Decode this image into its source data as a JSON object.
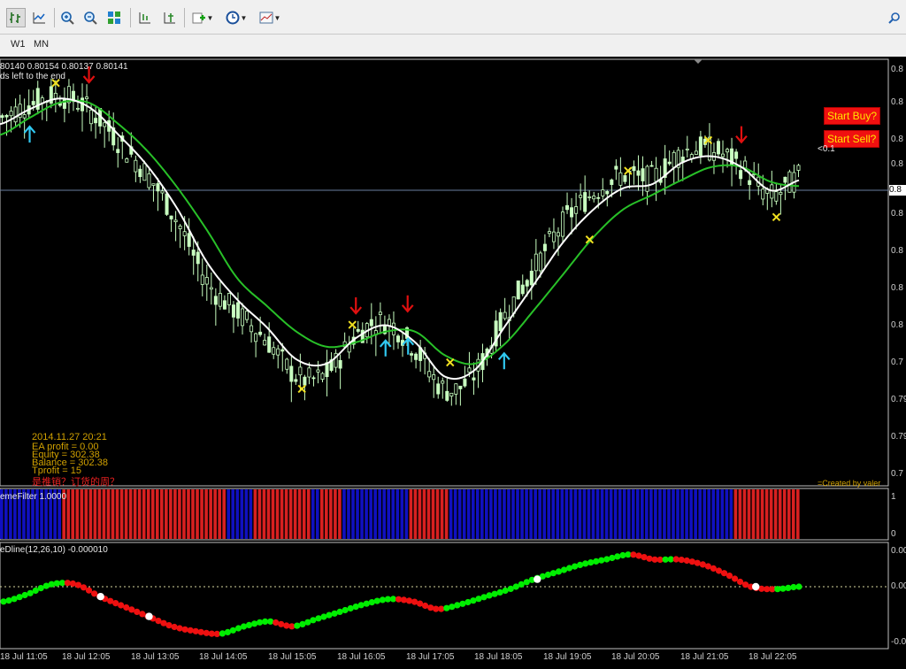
{
  "toolbar": {
    "buttons": [
      {
        "name": "bar-chart-button",
        "icon": "bar-chart-icon"
      },
      {
        "name": "line-chart-button",
        "icon": "line-chart-icon"
      },
      {
        "name": "zoom-in-button",
        "icon": "zoom-in-icon"
      },
      {
        "name": "zoom-out-button",
        "icon": "zoom-out-icon"
      },
      {
        "name": "tile-windows-button",
        "icon": "tile-icon"
      },
      {
        "name": "chart-shift-button",
        "icon": "chart-shift-icon"
      },
      {
        "name": "autoscroll-button",
        "icon": "autoscroll-icon"
      },
      {
        "name": "add-indicator-button",
        "icon": "add-indicator-icon"
      },
      {
        "name": "periods-button",
        "icon": "clock-icon"
      },
      {
        "name": "templates-button",
        "icon": "template-icon"
      }
    ],
    "search_icon": "search-icon"
  },
  "periods": [
    "W1",
    "MN"
  ],
  "main_chart": {
    "ohlc_header": "80140 0.80154 0.80137 0.80141",
    "countdown_label": "ds left to the end",
    "start_buy_label": "Start Buy?",
    "start_sell_label": "Start Sell?",
    "side_value": "<0.1",
    "credit": "=Created by valer",
    "info": {
      "datetime": "2014.11.27 20:21",
      "ea_profit": "EA profit = 0.00",
      "equity": "Equity = 302.38",
      "balance": "Balance = 302.38",
      "tprofit": "Tprofit = 15",
      "warning": "是推销？订货的周？"
    },
    "price_axis_labels": [
      "0.8",
      "0.8",
      "0.8",
      "0.8",
      "0.8",
      "0.8",
      "0.8",
      "0.8",
      "0.7",
      "0.79",
      "0.79",
      "0.7",
      "0.79",
      "0.79"
    ],
    "current_price_label": "0.8"
  },
  "filter_pane": {
    "label": "emeFilter 1.0000",
    "axis_top": "1",
    "axis_bottom": "0"
  },
  "macd_pane": {
    "label": "eDline(12,26,10) -0.000010",
    "axis_top": "0.00",
    "axis_bottom": "0.00",
    "axis_low": "-0.00"
  },
  "time_axis": [
    "18 Jul 11:05",
    "18 Jul 12:05",
    "18 Jul 13:05",
    "18 Jul 14:05",
    "18 Jul 15:05",
    "18 Jul 16:05",
    "18 Jul 17:05",
    "18 Jul 18:05",
    "18 Jul 19:05",
    "18 Jul 20:05",
    "18 Jul 21:05",
    "18 Jul 22:05"
  ],
  "colors": {
    "bull": "#c8ffc0",
    "ma_fast": "#ffffff",
    "ma_slow": "#28c028",
    "filter_red": "#d82020",
    "filter_blue": "#1010c0",
    "dot_green": "#00ee00",
    "dot_red": "#ee1010",
    "arrow_up": "#30c8f0",
    "arrow_down": "#e01010",
    "cross": "#f0e020"
  },
  "chart_data": {
    "type": "line",
    "series": [
      {
        "values": [
          0.808,
          0.8087,
          0.8092,
          0.8088,
          0.8075,
          0.806,
          0.804,
          0.8015,
          0.7998,
          0.7985,
          0.797,
          0.7968,
          0.798,
          0.7986,
          0.7978,
          0.7962,
          0.7965,
          0.7985,
          0.8005,
          0.8025,
          0.804,
          0.805,
          0.8052,
          0.8062,
          0.8065,
          0.806,
          0.8049,
          0.8054
        ]
      },
      {
        "values": [
          0.8075,
          0.8083,
          0.809,
          0.809,
          0.808,
          0.8067,
          0.805,
          0.803,
          0.8008,
          0.7995,
          0.7983,
          0.7976,
          0.7978,
          0.7983,
          0.7983,
          0.7972,
          0.7968,
          0.7977,
          0.7993,
          0.801,
          0.8027,
          0.804,
          0.8047,
          0.8054,
          0.806,
          0.806,
          0.8053,
          0.8051
        ]
      }
    ],
    "filter_states": [
      {
        "state": "blue",
        "bars": 14
      },
      {
        "state": "red",
        "bars": 37
      },
      {
        "state": "blue",
        "bars": 6
      },
      {
        "state": "red",
        "bars": 13
      },
      {
        "state": "blue",
        "bars": 2
      },
      {
        "state": "red",
        "bars": 5
      },
      {
        "state": "blue",
        "bars": 15
      },
      {
        "state": "red",
        "bars": 9
      },
      {
        "state": "blue",
        "bars": 64
      },
      {
        "state": "red",
        "bars": 15
      }
    ],
    "osc": {
      "values": [
        -0.6,
        -0.3,
        0.1,
        0.1,
        -0.4,
        -0.8,
        -1.2,
        -1.6,
        -1.8,
        -1.9,
        -1.6,
        -1.4,
        -1.6,
        -1.3,
        -1.0,
        -0.7,
        -0.5,
        -0.6,
        -0.9,
        -0.7,
        -0.4,
        -0.1,
        0.3,
        0.6,
        0.9,
        1.1,
        1.3,
        1.1,
        1.1,
        0.9,
        0.5,
        0.0,
        -0.1,
        0.0
      ],
      "signal_indices": [
        4,
        6,
        22,
        31
      ]
    },
    "arrows_up": [
      1,
      13,
      14,
      17
    ],
    "arrows_down": [
      3,
      12,
      13,
      25
    ],
    "crosses": [
      2,
      10,
      12,
      15,
      20,
      21,
      24,
      26
    ]
  }
}
